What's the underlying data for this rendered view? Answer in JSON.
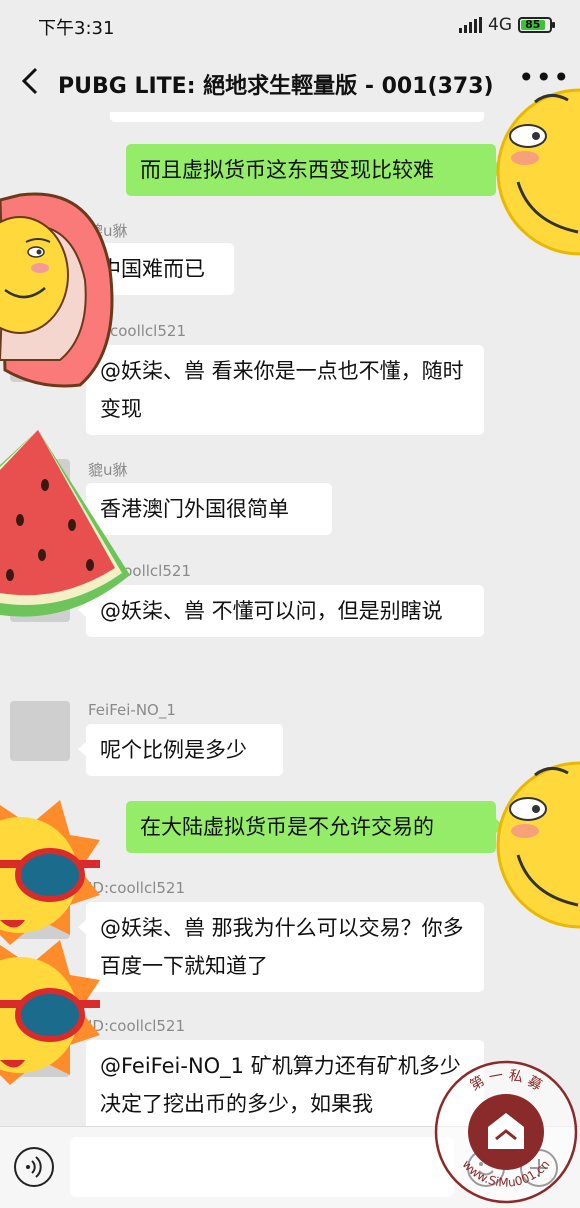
{
  "status": {
    "time": "下午3:31",
    "network": "4G",
    "battery": "85"
  },
  "header": {
    "title": "PUBG LITE: 絕地求生輕量版 - 001(373)"
  },
  "messages": [
    {
      "side": "out",
      "text": "而且虚拟货币这东西变现比较难"
    },
    {
      "side": "in",
      "sender": "貔u貅",
      "text": "中国难而已"
    },
    {
      "side": "in",
      "sender": "coollcl521",
      "text": "@妖柒、兽  看来你是一点也不懂，随时变现"
    },
    {
      "side": "in",
      "sender": "貔u貅",
      "text": "香港澳门外国很简单"
    },
    {
      "side": "in",
      "sender": "coollcl521",
      "text": "@妖柒、兽  不懂可以问，但是别瞎说"
    },
    {
      "side": "in",
      "sender": "FeiFei-NO_1",
      "text": "呢个比例是多少"
    },
    {
      "side": "out",
      "text": "在大陆虚拟货币是不允许交易的"
    },
    {
      "side": "in",
      "sender": "ID:coollcl521",
      "text": "@妖柒、兽  那我为什么可以交易？你多百度一下就知道了"
    },
    {
      "side": "in",
      "sender": "ID:coollcl521",
      "text": "@FeiFei-NO_1 矿机算力还有矿机多少决定了挖出币的多少，如果我"
    }
  ],
  "watermark": {
    "top_text": "第 一 私 募",
    "bottom_text": "www.SiMu001.cn"
  },
  "colors": {
    "background": "#ededed",
    "outgoing_bubble": "#95ec69",
    "incoming_bubble": "#ffffff",
    "sticker_yellow": "#ffd93b"
  }
}
